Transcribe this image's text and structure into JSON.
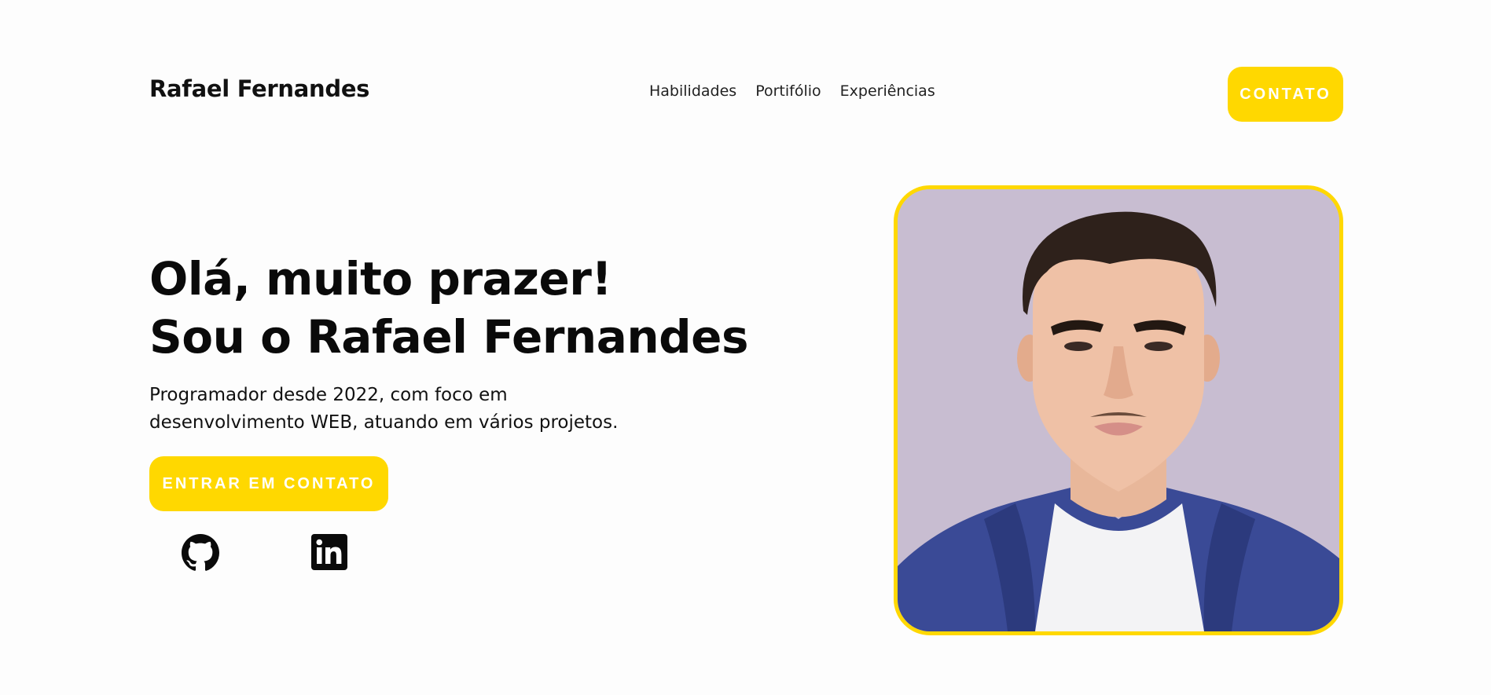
{
  "header": {
    "logo": "Rafael Fernandes",
    "nav": [
      {
        "label": "Habilidades"
      },
      {
        "label": "Portifólio"
      },
      {
        "label": "Experiências"
      }
    ],
    "contact_button": "CONTATO"
  },
  "hero": {
    "title_line1": "Olá, muito prazer!",
    "title_line2": "Sou o Rafael Fernandes",
    "subtitle": "Programador desde 2022, com foco em desenvolvimento WEB, atuando em vários projetos.",
    "cta_button": "ENTRAR EM CONTATO",
    "social": [
      {
        "icon": "github-icon"
      },
      {
        "icon": "linkedin-icon"
      }
    ]
  },
  "portrait": {
    "icon": "profile-photo"
  },
  "colors": {
    "accent": "#ffd800",
    "background": "#fdfdfd",
    "text": "#111111"
  }
}
